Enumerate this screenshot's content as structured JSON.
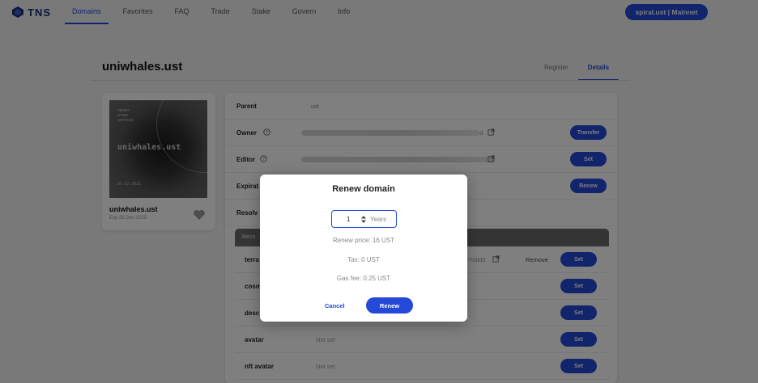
{
  "brand": {
    "name": "TNS",
    "color": "#1d2f6f"
  },
  "nav": {
    "items": [
      "Domains",
      "Favorites",
      "FAQ",
      "Trade",
      "Stake",
      "Govern",
      "Info"
    ],
    "active": "Domains"
  },
  "wallet": {
    "label": "spiral.ust | Mainnet"
  },
  "domain": {
    "name": "uniwhales.ust"
  },
  "tabs": {
    "register": "Register",
    "details": "Details",
    "active": "Details"
  },
  "nft_card": {
    "brand_lines": [
      "TERRA",
      "NAME",
      "SERVICE"
    ],
    "image_name": "uniwhales.ust",
    "image_date": "26.12.2021",
    "name": "uniwhales.ust",
    "expiry": "Exp 25 Dec 2025",
    "favorite_icon": "heart-icon"
  },
  "details": {
    "parent": {
      "label": "Parent",
      "value": "ust"
    },
    "owner": {
      "label": "Owner",
      "value_suffix": "d",
      "button": "Transfer"
    },
    "editor": {
      "label": "Editor",
      "button": "Set"
    },
    "expiration": {
      "label": "Expirat",
      "button": "Renew"
    },
    "resolver": {
      "label": "Resolv"
    },
    "records": {
      "title": "Reco",
      "rows": [
        {
          "label": "terra",
          "value": "70didd",
          "remove": "Remove",
          "button": "Set"
        },
        {
          "label": "cosm",
          "value": "",
          "button": "Set"
        },
        {
          "label": "desc",
          "value": "",
          "button": "Set"
        },
        {
          "label": "avatar",
          "value": "Not set",
          "button": "Set"
        },
        {
          "label": "nft avatar",
          "value": "Not set",
          "button": "Set"
        }
      ]
    }
  },
  "modal": {
    "title": "Renew domain",
    "years_value": "1",
    "years_unit": "Years",
    "renew_price": "Renew price: 16 UST",
    "tax": "Tax: 0 UST",
    "gas_fee": "Gas fee: 0.25 UST",
    "cancel": "Cancel",
    "renew": "Renew"
  },
  "colors": {
    "accent": "#2449d8",
    "overlay": "rgba(0,0,0,0.5)"
  }
}
